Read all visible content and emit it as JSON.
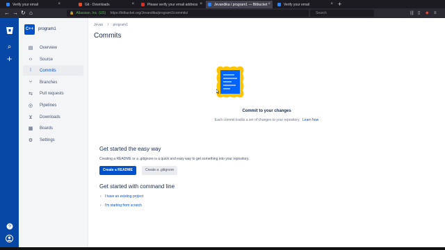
{
  "browser": {
    "tabs": [
      {
        "title": "Verify your email",
        "color": "#ffffff"
      },
      {
        "title": "Git - Downloads",
        "color": "#e44d26"
      },
      {
        "title": "Please verify your email address",
        "color": "#d93025"
      },
      {
        "title": "Jevandika / program1 — Bitbucket",
        "color": "#2684ff"
      },
      {
        "title": "Verify your email",
        "color": "#ffffff"
      }
    ],
    "new_tab": "+",
    "url_site": "Atlassian, Inc. (US)",
    "url": "https://bitbucket.org/Jevandika/program1/commits/",
    "search_placeholder": "Search"
  },
  "sidebar": {
    "project_logo": "C++",
    "project_name": "program1",
    "items": [
      {
        "label": "Overview",
        "icon": "overview-icon",
        "glyph": "▤"
      },
      {
        "label": "Source",
        "icon": "code-icon",
        "glyph": "‹›"
      },
      {
        "label": "Commits",
        "icon": "commit-icon",
        "glyph": "⦚"
      },
      {
        "label": "Branches",
        "icon": "branch-icon",
        "glyph": "⑂"
      },
      {
        "label": "Pull requests",
        "icon": "pull-request-icon",
        "glyph": "⇆"
      },
      {
        "label": "Pipelines",
        "icon": "pipelines-icon",
        "glyph": "◎"
      },
      {
        "label": "Downloads",
        "icon": "download-icon",
        "glyph": "⊻"
      },
      {
        "label": "Boards",
        "icon": "board-icon",
        "glyph": "▦"
      },
      {
        "label": "Settings",
        "icon": "gear-icon",
        "glyph": "⚙"
      }
    ]
  },
  "main": {
    "breadcrumb": [
      "Jevan",
      "/",
      "program1"
    ],
    "title": "Commits",
    "empty_title": "Commit to your changes",
    "empty_text": "Each commit tracks a set of changes to your repository.",
    "empty_link": "Learn how",
    "easy_heading": "Get started the easy way",
    "easy_text": "Creating a README or a .gitignore is a quick and easy way to get something into your repository.",
    "readme_button": "Create a README",
    "gitignore_button": "Create a .gitignore",
    "cli_heading": "Get started with command line",
    "cli_option1": "I have an existing project",
    "cli_option2": "I'm starting from scratch"
  },
  "colors": {
    "global_nav": "#0747a6",
    "accent": "#0052cc",
    "illustration_frame": "#ffc400"
  }
}
